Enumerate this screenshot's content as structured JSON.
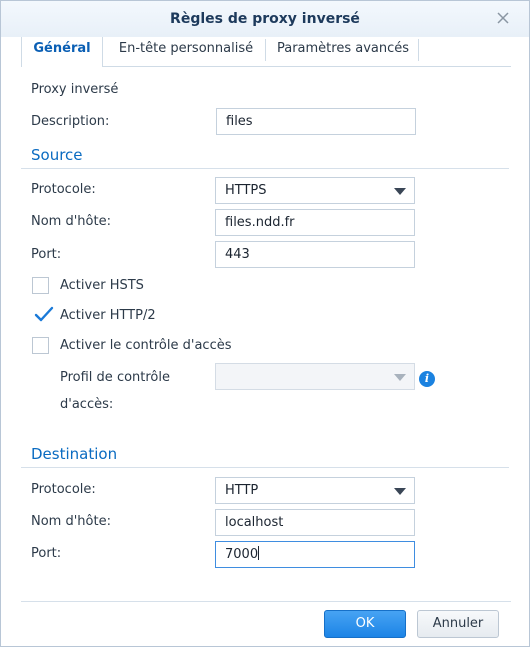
{
  "dialog": {
    "title": "Règles de proxy inversé"
  },
  "tabs": [
    {
      "label": "Général"
    },
    {
      "label": "En-tête personnalisé"
    },
    {
      "label": "Paramètres avancés"
    }
  ],
  "general": {
    "section_label": "Proxy inversé",
    "description_label": "Description:",
    "description_value": "files"
  },
  "source": {
    "heading": "Source",
    "protocol_label": "Protocole:",
    "protocol_value": "HTTPS",
    "hostname_label": "Nom d'hôte:",
    "hostname_value": "files.ndd.fr",
    "port_label": "Port:",
    "port_value": "443",
    "hsts_label": "Activer HSTS",
    "hsts_checked": false,
    "http2_label": "Activer HTTP/2",
    "http2_checked": true,
    "access_control_label": "Activer le contrôle d'accès",
    "access_control_checked": false,
    "profile_label_line1": "Profil de contrôle",
    "profile_label_line2": "d'accès:",
    "profile_value": ""
  },
  "destination": {
    "heading": "Destination",
    "protocol_label": "Protocole:",
    "protocol_value": "HTTP",
    "hostname_label": "Nom d'hôte:",
    "hostname_value": "localhost",
    "port_label": "Port:",
    "port_value": "7000"
  },
  "buttons": {
    "ok": "OK",
    "cancel": "Annuler"
  },
  "icons": {
    "close": "close-icon",
    "info": "info-icon",
    "check": "checkmark-icon"
  },
  "colors": {
    "accent": "#0a6bc1",
    "primary_button": "#1c84e6",
    "info": "#1b82e0"
  }
}
